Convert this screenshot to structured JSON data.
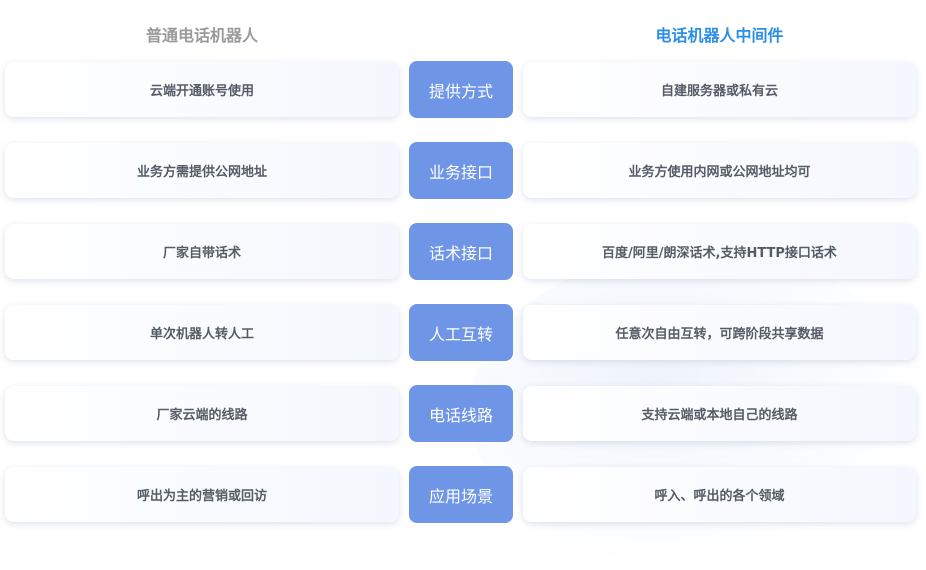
{
  "headers": {
    "left": "普通电话机器人",
    "right": "电话机器人中间件"
  },
  "rows": [
    {
      "left": "云端开通账号使用",
      "middle": "提供方式",
      "right": "自建服务器或私有云"
    },
    {
      "left": "业务方需提供公网地址",
      "middle": "业务接口",
      "right": "业务方使用内网或公网地址均可"
    },
    {
      "left": "厂家自带话术",
      "middle": "话术接口",
      "right": "百度/阿里/朗深话术,支持HTTP接口话术"
    },
    {
      "left": "单次机器人转人工",
      "middle": "人工互转",
      "right": "任意次自由互转，可跨阶段共享数据"
    },
    {
      "left": "厂家云端的线路",
      "middle": "电话线路",
      "right": "支持云端或本地自己的线路"
    },
    {
      "left": "呼出为主的营销或回访",
      "middle": "应用场景",
      "right": "呼入、呼出的各个领域"
    }
  ]
}
